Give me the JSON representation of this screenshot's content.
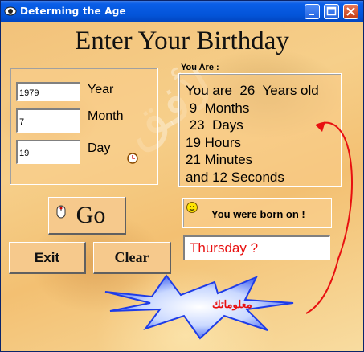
{
  "window": {
    "title": "Determing the Age"
  },
  "heading": "Enter Your Birthday",
  "inputs": {
    "year": {
      "value": "1979",
      "label": "Year"
    },
    "month": {
      "value": "7",
      "label": "Month"
    },
    "day": {
      "value": "19",
      "label": "Day"
    }
  },
  "buttons": {
    "go": "Go",
    "exit": "Exit",
    "clear": "Clear"
  },
  "result": {
    "caption": "You Are :",
    "lines": [
      "You are  26  Years old",
      " 9  Months",
      " 23  Days",
      "19 Hours",
      "21 Minutes",
      "and 12 Seconds"
    ]
  },
  "born_on": {
    "label": "You were born on !",
    "value": "Thursday ?"
  },
  "starburst": {
    "text": "معلوماتك"
  },
  "watermark": {
    "text": "لأفق"
  },
  "icons": [
    "app-icon",
    "minimize-icon",
    "maximize-icon",
    "close-icon",
    "clock-icon",
    "mouse-cursor-icon",
    "smiley-icon",
    "curved-arrow-icon"
  ],
  "colors": {
    "accent_red": "#e81010",
    "title_blue": "#0a5ee8",
    "background": "#f2c27a"
  }
}
